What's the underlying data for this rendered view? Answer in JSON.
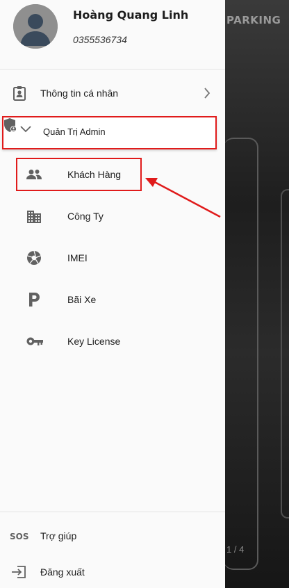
{
  "background": {
    "brand": "PARKING",
    "page_counter": "1 / 4"
  },
  "profile": {
    "name": "Hoàng Quang Linh",
    "phone": "0355536734"
  },
  "menu": {
    "personal_info": "Thông tin cá nhân",
    "admin_section": "Quản Trị Admin",
    "admin_items": [
      {
        "label": "Khách Hàng",
        "icon": "people-icon"
      },
      {
        "label": "Công Ty",
        "icon": "building-icon"
      },
      {
        "label": "IMEI",
        "icon": "camera-shutter-icon"
      },
      {
        "label": "Bãi Xe",
        "icon": "parking-icon"
      },
      {
        "label": "Key License",
        "icon": "key-icon"
      }
    ],
    "help": "Trợ giúp",
    "logout": "Đăng xuất"
  },
  "colors": {
    "highlight": "#e01b1b",
    "icon": "#616161"
  }
}
